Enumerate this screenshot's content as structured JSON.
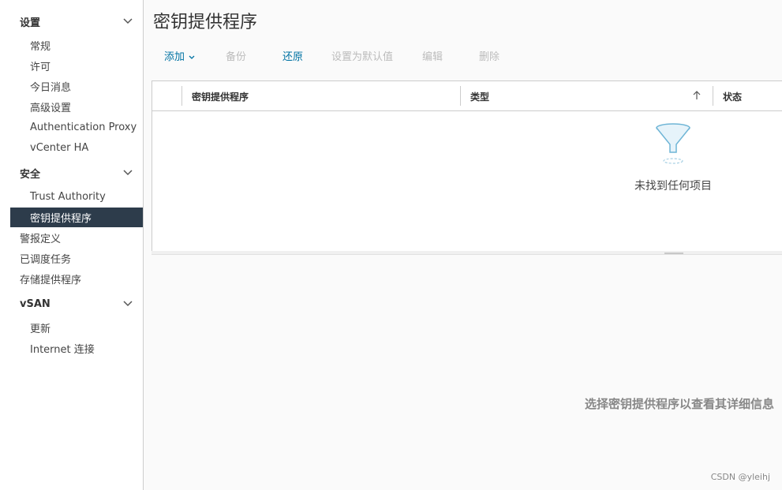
{
  "sidebar": {
    "settings": {
      "label": "设置",
      "items": [
        "常规",
        "许可",
        "今日消息",
        "高级设置",
        "Authentication Proxy",
        "vCenter HA"
      ]
    },
    "security": {
      "label": "安全",
      "items": [
        "Trust Authority",
        "密钥提供程序"
      ]
    },
    "top_items": [
      "警报定义",
      "已调度任务",
      "存储提供程序"
    ],
    "vsan": {
      "label": "vSAN",
      "items": [
        "更新",
        "Internet 连接"
      ]
    }
  },
  "main": {
    "title": "密钥提供程序",
    "toolbar": {
      "add": "添加",
      "backup": "备份",
      "restore": "还原",
      "set_default": "设置为默认值",
      "edit": "编辑",
      "delete": "删除"
    },
    "grid": {
      "columns": [
        "密钥提供程序",
        "类型",
        "状态"
      ],
      "sort_arrow": "↑",
      "empty_text": "未找到任何项目"
    },
    "detail_hint": "选择密钥提供程序以查看其详细信息",
    "watermark": "CSDN @yleihj"
  },
  "colors": {
    "accent": "#0072a3",
    "active_nav_bg": "#2d3c4b",
    "disabled_text": "#bcbcbc"
  },
  "icons": {
    "chevron": "chevron-down-icon",
    "empty": "funnel-icon",
    "sort": "arrow-up-icon"
  }
}
